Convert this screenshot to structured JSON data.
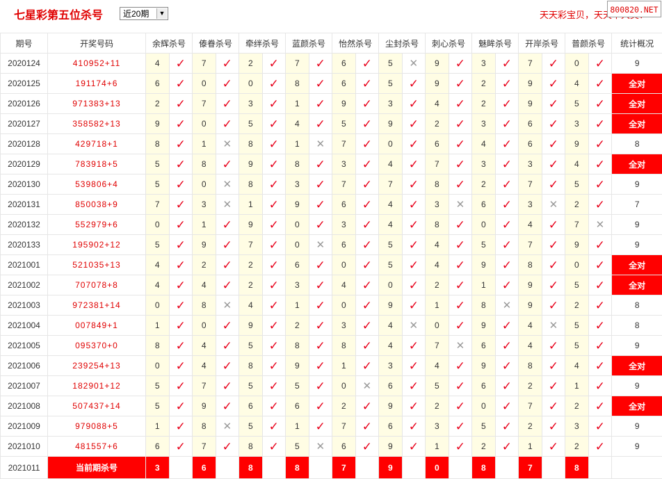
{
  "header": {
    "title": "七星彩第五位杀号",
    "period_select": "近20期",
    "slogan": "天天彩宝贝，天天中大奖！",
    "watermark": "800820.NET"
  },
  "columns": {
    "period": "期号",
    "draw": "开奖号码",
    "methods": [
      "余辉杀号",
      "傣眷杀号",
      "牵绊杀号",
      "蓝颜杀号",
      "怡然杀号",
      "尘封杀号",
      "刺心杀号",
      "魅眸杀号",
      "开岸杀号",
      "普颜杀号"
    ],
    "stats": "统计概况"
  },
  "rows": [
    {
      "period": "2020124",
      "draw": "410952+11",
      "vals": [
        [
          "4",
          1
        ],
        [
          "7",
          1
        ],
        [
          "2",
          1
        ],
        [
          "7",
          1
        ],
        [
          "6",
          1
        ],
        [
          "5",
          0
        ],
        [
          "9",
          1
        ],
        [
          "3",
          1
        ],
        [
          "7",
          1
        ],
        [
          "0",
          1
        ]
      ],
      "stat": "9",
      "all": false
    },
    {
      "period": "2020125",
      "draw": "191174+6",
      "vals": [
        [
          "6",
          1
        ],
        [
          "0",
          1
        ],
        [
          "0",
          1
        ],
        [
          "8",
          1
        ],
        [
          "6",
          1
        ],
        [
          "5",
          1
        ],
        [
          "9",
          1
        ],
        [
          "2",
          1
        ],
        [
          "9",
          1
        ],
        [
          "4",
          1
        ]
      ],
      "stat": "全对",
      "all": true
    },
    {
      "period": "2020126",
      "draw": "971383+13",
      "vals": [
        [
          "2",
          1
        ],
        [
          "7",
          1
        ],
        [
          "3",
          1
        ],
        [
          "1",
          1
        ],
        [
          "9",
          1
        ],
        [
          "3",
          1
        ],
        [
          "4",
          1
        ],
        [
          "2",
          1
        ],
        [
          "9",
          1
        ],
        [
          "5",
          1
        ]
      ],
      "stat": "全对",
      "all": true
    },
    {
      "period": "2020127",
      "draw": "358582+13",
      "vals": [
        [
          "9",
          1
        ],
        [
          "0",
          1
        ],
        [
          "5",
          1
        ],
        [
          "4",
          1
        ],
        [
          "5",
          1
        ],
        [
          "9",
          1
        ],
        [
          "2",
          1
        ],
        [
          "3",
          1
        ],
        [
          "6",
          1
        ],
        [
          "3",
          1
        ]
      ],
      "stat": "全对",
      "all": true
    },
    {
      "period": "2020128",
      "draw": "429718+1",
      "vals": [
        [
          "8",
          1
        ],
        [
          "1",
          0
        ],
        [
          "8",
          1
        ],
        [
          "1",
          0
        ],
        [
          "7",
          1
        ],
        [
          "0",
          1
        ],
        [
          "6",
          1
        ],
        [
          "4",
          1
        ],
        [
          "6",
          1
        ],
        [
          "9",
          1
        ]
      ],
      "stat": "8",
      "all": false
    },
    {
      "period": "2020129",
      "draw": "783918+5",
      "vals": [
        [
          "5",
          1
        ],
        [
          "8",
          1
        ],
        [
          "9",
          1
        ],
        [
          "8",
          1
        ],
        [
          "3",
          1
        ],
        [
          "4",
          1
        ],
        [
          "7",
          1
        ],
        [
          "3",
          1
        ],
        [
          "3",
          1
        ],
        [
          "4",
          1
        ]
      ],
      "stat": "全对",
      "all": true
    },
    {
      "period": "2020130",
      "draw": "539806+4",
      "vals": [
        [
          "5",
          1
        ],
        [
          "0",
          0
        ],
        [
          "8",
          1
        ],
        [
          "3",
          1
        ],
        [
          "7",
          1
        ],
        [
          "7",
          1
        ],
        [
          "8",
          1
        ],
        [
          "2",
          1
        ],
        [
          "7",
          1
        ],
        [
          "5",
          1
        ]
      ],
      "stat": "9",
      "all": false
    },
    {
      "period": "2020131",
      "draw": "850038+9",
      "vals": [
        [
          "7",
          1
        ],
        [
          "3",
          0
        ],
        [
          "1",
          1
        ],
        [
          "9",
          1
        ],
        [
          "6",
          1
        ],
        [
          "4",
          1
        ],
        [
          "3",
          0
        ],
        [
          "6",
          1
        ],
        [
          "3",
          0
        ],
        [
          "2",
          1
        ]
      ],
      "stat": "7",
      "all": false
    },
    {
      "period": "2020132",
      "draw": "552979+6",
      "vals": [
        [
          "0",
          1
        ],
        [
          "1",
          1
        ],
        [
          "9",
          1
        ],
        [
          "0",
          1
        ],
        [
          "3",
          1
        ],
        [
          "4",
          1
        ],
        [
          "8",
          1
        ],
        [
          "0",
          1
        ],
        [
          "4",
          1
        ],
        [
          "7",
          0
        ]
      ],
      "stat": "9",
      "all": false
    },
    {
      "period": "2020133",
      "draw": "195902+12",
      "vals": [
        [
          "5",
          1
        ],
        [
          "9",
          1
        ],
        [
          "7",
          1
        ],
        [
          "0",
          0
        ],
        [
          "6",
          1
        ],
        [
          "5",
          1
        ],
        [
          "4",
          1
        ],
        [
          "5",
          1
        ],
        [
          "7",
          1
        ],
        [
          "9",
          1
        ]
      ],
      "stat": "9",
      "all": false
    },
    {
      "period": "2021001",
      "draw": "521035+13",
      "vals": [
        [
          "4",
          1
        ],
        [
          "2",
          1
        ],
        [
          "2",
          1
        ],
        [
          "6",
          1
        ],
        [
          "0",
          1
        ],
        [
          "5",
          1
        ],
        [
          "4",
          1
        ],
        [
          "9",
          1
        ],
        [
          "8",
          1
        ],
        [
          "0",
          1
        ]
      ],
      "stat": "全对",
      "all": true
    },
    {
      "period": "2021002",
      "draw": "707078+8",
      "vals": [
        [
          "4",
          1
        ],
        [
          "4",
          1
        ],
        [
          "2",
          1
        ],
        [
          "3",
          1
        ],
        [
          "4",
          1
        ],
        [
          "0",
          1
        ],
        [
          "2",
          1
        ],
        [
          "1",
          1
        ],
        [
          "9",
          1
        ],
        [
          "5",
          1
        ]
      ],
      "stat": "全对",
      "all": true
    },
    {
      "period": "2021003",
      "draw": "972381+14",
      "vals": [
        [
          "0",
          1
        ],
        [
          "8",
          0
        ],
        [
          "4",
          1
        ],
        [
          "1",
          1
        ],
        [
          "0",
          1
        ],
        [
          "9",
          1
        ],
        [
          "1",
          1
        ],
        [
          "8",
          0
        ],
        [
          "9",
          1
        ],
        [
          "2",
          1
        ]
      ],
      "stat": "8",
      "all": false
    },
    {
      "period": "2021004",
      "draw": "007849+1",
      "vals": [
        [
          "1",
          1
        ],
        [
          "0",
          1
        ],
        [
          "9",
          1
        ],
        [
          "2",
          1
        ],
        [
          "3",
          1
        ],
        [
          "4",
          0
        ],
        [
          "0",
          1
        ],
        [
          "9",
          1
        ],
        [
          "4",
          0
        ],
        [
          "5",
          1
        ]
      ],
      "stat": "8",
      "all": false
    },
    {
      "period": "2021005",
      "draw": "095370+0",
      "vals": [
        [
          "8",
          1
        ],
        [
          "4",
          1
        ],
        [
          "5",
          1
        ],
        [
          "8",
          1
        ],
        [
          "8",
          1
        ],
        [
          "4",
          1
        ],
        [
          "7",
          0
        ],
        [
          "6",
          1
        ],
        [
          "4",
          1
        ],
        [
          "5",
          1
        ]
      ],
      "stat": "9",
      "all": false
    },
    {
      "period": "2021006",
      "draw": "239254+13",
      "vals": [
        [
          "0",
          1
        ],
        [
          "4",
          1
        ],
        [
          "8",
          1
        ],
        [
          "9",
          1
        ],
        [
          "1",
          1
        ],
        [
          "3",
          1
        ],
        [
          "4",
          1
        ],
        [
          "9",
          1
        ],
        [
          "8",
          1
        ],
        [
          "4",
          1
        ]
      ],
      "stat": "全对",
      "all": true
    },
    {
      "period": "2021007",
      "draw": "182901+12",
      "vals": [
        [
          "5",
          1
        ],
        [
          "7",
          1
        ],
        [
          "5",
          1
        ],
        [
          "5",
          1
        ],
        [
          "0",
          0
        ],
        [
          "6",
          1
        ],
        [
          "5",
          1
        ],
        [
          "6",
          1
        ],
        [
          "2",
          1
        ],
        [
          "1",
          1
        ]
      ],
      "stat": "9",
      "all": false
    },
    {
      "period": "2021008",
      "draw": "507437+14",
      "vals": [
        [
          "5",
          1
        ],
        [
          "9",
          1
        ],
        [
          "6",
          1
        ],
        [
          "6",
          1
        ],
        [
          "2",
          1
        ],
        [
          "9",
          1
        ],
        [
          "2",
          1
        ],
        [
          "0",
          1
        ],
        [
          "7",
          1
        ],
        [
          "2",
          1
        ]
      ],
      "stat": "全对",
      "all": true
    },
    {
      "period": "2021009",
      "draw": "979088+5",
      "vals": [
        [
          "1",
          1
        ],
        [
          "8",
          0
        ],
        [
          "5",
          1
        ],
        [
          "1",
          1
        ],
        [
          "7",
          1
        ],
        [
          "6",
          1
        ],
        [
          "3",
          1
        ],
        [
          "5",
          1
        ],
        [
          "2",
          1
        ],
        [
          "3",
          1
        ]
      ],
      "stat": "9",
      "all": false
    },
    {
      "period": "2021010",
      "draw": "481557+6",
      "vals": [
        [
          "6",
          1
        ],
        [
          "7",
          1
        ],
        [
          "8",
          1
        ],
        [
          "5",
          0
        ],
        [
          "6",
          1
        ],
        [
          "9",
          1
        ],
        [
          "1",
          1
        ],
        [
          "2",
          1
        ],
        [
          "1",
          1
        ],
        [
          "2",
          1
        ]
      ],
      "stat": "9",
      "all": false
    }
  ],
  "current": {
    "period": "2021011",
    "label": "当前期杀号",
    "vals": [
      "3",
      "6",
      "8",
      "8",
      "7",
      "9",
      "0",
      "8",
      "7",
      "8"
    ]
  },
  "icons": {
    "correct": "check-icon",
    "wrong": "cross-icon"
  },
  "colors": {
    "accent": "#e00000",
    "stat_all_bg": "#ff0000",
    "value_bg": "#fffde4"
  }
}
